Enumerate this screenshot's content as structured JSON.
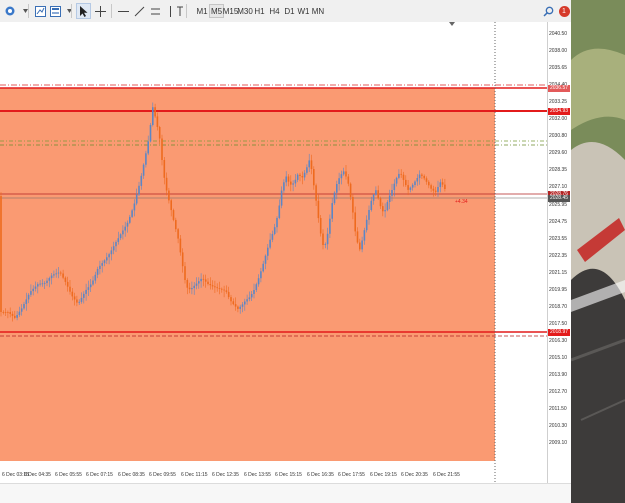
{
  "toolbar": {
    "timeframes": [
      "M1",
      "M5",
      "M15",
      "M30",
      "H1",
      "H4",
      "D1",
      "W1",
      "MN"
    ],
    "selected_timeframe": "M5",
    "notification_count": "1"
  },
  "chart": {
    "price_ticks": [
      "2040.50",
      "2038.00",
      "2035.65",
      "2034.40",
      "2033.25",
      "2032.00",
      "2030.80",
      "2029.60",
      "2028.35",
      "2027.10",
      "2025.95",
      "2024.75",
      "2023.55",
      "2022.35",
      "2021.15",
      "2019.95",
      "2018.70",
      "2017.50",
      "2016.30",
      "2015.10",
      "2013.90",
      "2012.70",
      "2011.50",
      "2010.30",
      "2009.10"
    ],
    "time_ticks": [
      "6 Dec 03:15",
      "6 Dec 04:35",
      "6 Dec 05:55",
      "6 Dec 07:15",
      "6 Dec 08:35",
      "6 Dec 09:55",
      "6 Dec 11:15",
      "6 Dec 12:35",
      "6 Dec 13:55",
      "6 Dec 15:15",
      "6 Dec 16:35",
      "6 Dec 17:55",
      "6 Dec 19:15",
      "6 Dec 20:35",
      "6 Dec 21:55"
    ],
    "level_tags": {
      "top_dashed": "2036.57",
      "resistance": "2034.93",
      "current": "2028.76",
      "bid": "2028.45",
      "support": "2018.97"
    },
    "trade_profit": "+4.34",
    "colors": {
      "zone_fill": "#fa9a72",
      "candle_up": "#5b86c6",
      "candle_down": "#ee6a1e",
      "line_red": "#e31b1b",
      "level_dark": "#c0392b"
    }
  }
}
